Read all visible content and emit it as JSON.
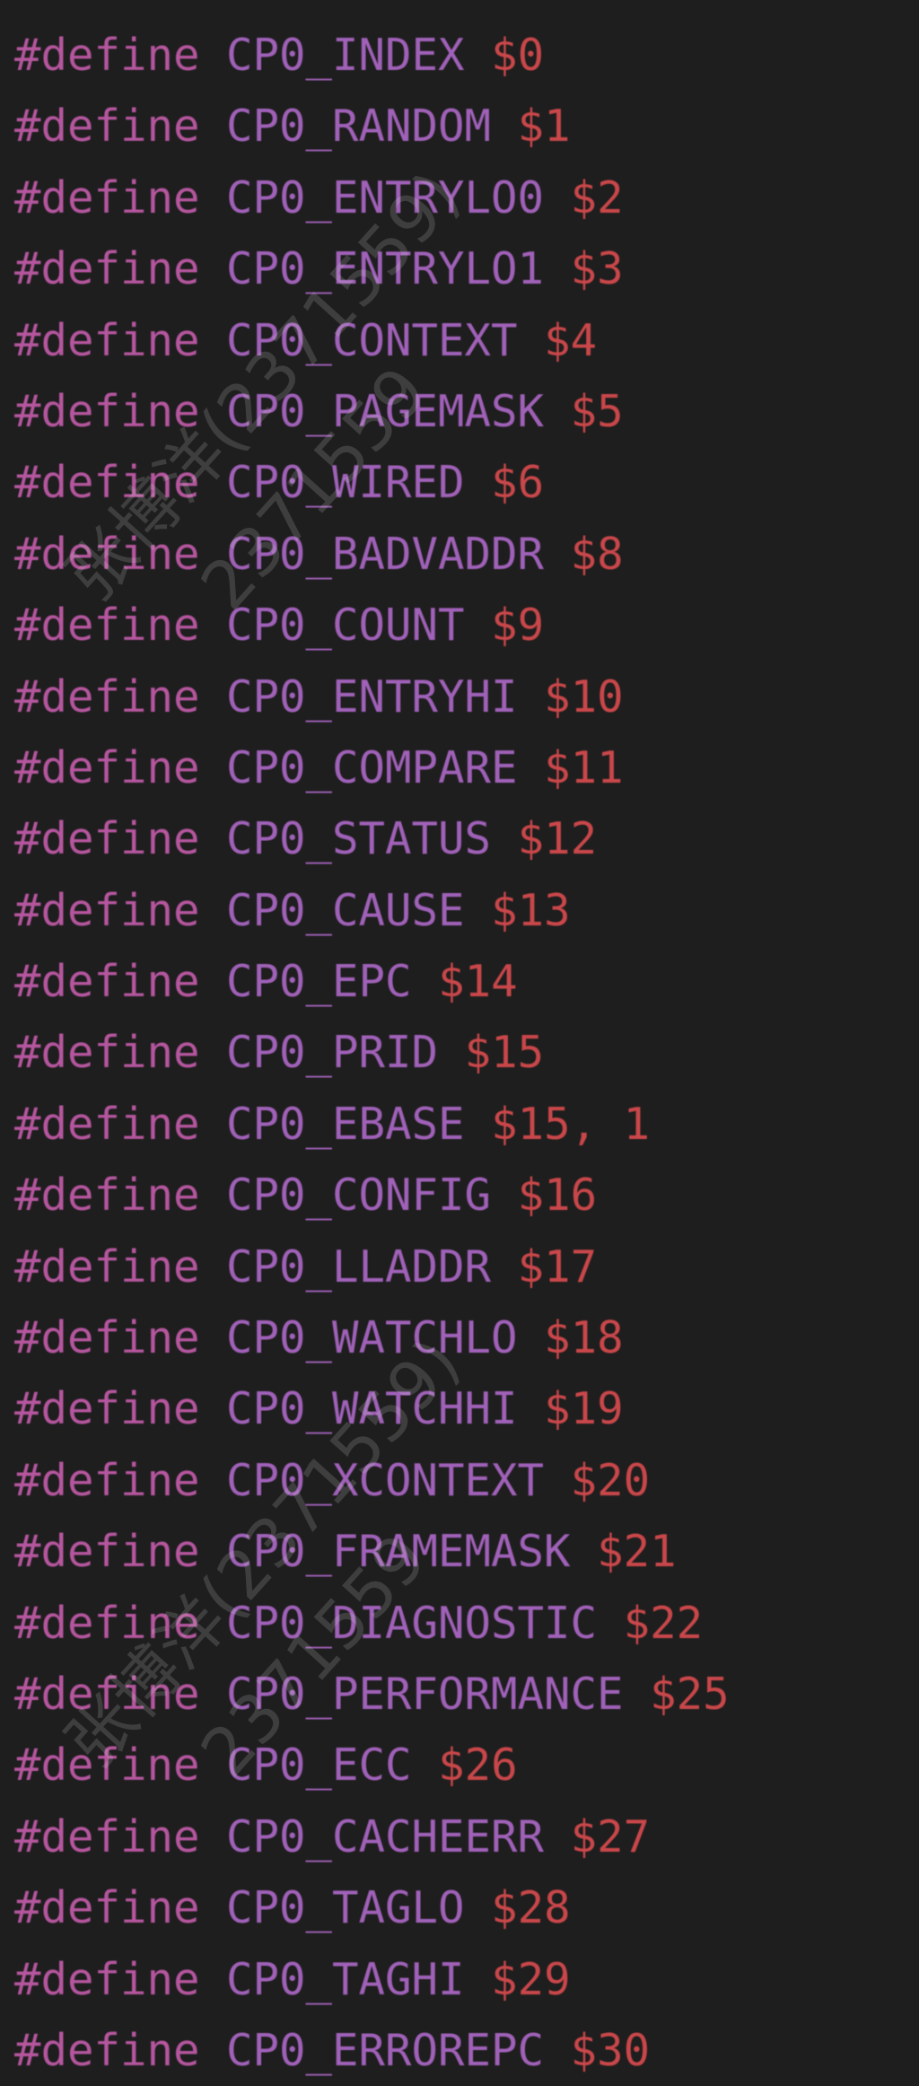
{
  "editor": {
    "lines": [
      {
        "keyword": "#define",
        "name": "CP0_INDEX",
        "value": "$0"
      },
      {
        "keyword": "#define",
        "name": "CP0_RANDOM",
        "value": "$1"
      },
      {
        "keyword": "#define",
        "name": "CP0_ENTRYLO0",
        "value": "$2"
      },
      {
        "keyword": "#define",
        "name": "CP0_ENTRYLO1",
        "value": "$3"
      },
      {
        "keyword": "#define",
        "name": "CP0_CONTEXT",
        "value": "$4"
      },
      {
        "keyword": "#define",
        "name": "CP0_PAGEMASK",
        "value": "$5"
      },
      {
        "keyword": "#define",
        "name": "CP0_WIRED",
        "value": "$6"
      },
      {
        "keyword": "#define",
        "name": "CP0_BADVADDR",
        "value": "$8"
      },
      {
        "keyword": "#define",
        "name": "CP0_COUNT",
        "value": "$9"
      },
      {
        "keyword": "#define",
        "name": "CP0_ENTRYHI",
        "value": "$10"
      },
      {
        "keyword": "#define",
        "name": "CP0_COMPARE",
        "value": "$11"
      },
      {
        "keyword": "#define",
        "name": "CP0_STATUS",
        "value": "$12"
      },
      {
        "keyword": "#define",
        "name": "CP0_CAUSE",
        "value": "$13"
      },
      {
        "keyword": "#define",
        "name": "CP0_EPC",
        "value": "$14"
      },
      {
        "keyword": "#define",
        "name": "CP0_PRID",
        "value": "$15"
      },
      {
        "keyword": "#define",
        "name": "CP0_EBASE",
        "value": "$15, 1"
      },
      {
        "keyword": "#define",
        "name": "CP0_CONFIG",
        "value": "$16"
      },
      {
        "keyword": "#define",
        "name": "CP0_LLADDR",
        "value": "$17"
      },
      {
        "keyword": "#define",
        "name": "CP0_WATCHLO",
        "value": "$18"
      },
      {
        "keyword": "#define",
        "name": "CP0_WATCHHI",
        "value": "$19"
      },
      {
        "keyword": "#define",
        "name": "CP0_XCONTEXT",
        "value": "$20"
      },
      {
        "keyword": "#define",
        "name": "CP0_FRAMEMASK",
        "value": "$21"
      },
      {
        "keyword": "#define",
        "name": "CP0_DIAGNOSTIC",
        "value": "$22"
      },
      {
        "keyword": "#define",
        "name": "CP0_PERFORMANCE",
        "value": "$25"
      },
      {
        "keyword": "#define",
        "name": "CP0_ECC",
        "value": "$26"
      },
      {
        "keyword": "#define",
        "name": "CP0_CACHEERR",
        "value": "$27"
      },
      {
        "keyword": "#define",
        "name": "CP0_TAGLO",
        "value": "$28"
      },
      {
        "keyword": "#define",
        "name": "CP0_TAGHI",
        "value": "$29"
      },
      {
        "keyword": "#define",
        "name": "CP0_ERROREPC",
        "value": "$30"
      }
    ]
  },
  "watermark": {
    "lines": [
      "张博洋(2371559)",
      "2371559",
      "张博洋(2371559)",
      "2371559"
    ]
  },
  "colors": {
    "background": "#1e1e1e",
    "keyword": "#b5569e",
    "macro_name": "#a061b8",
    "value": "#c9474a"
  }
}
